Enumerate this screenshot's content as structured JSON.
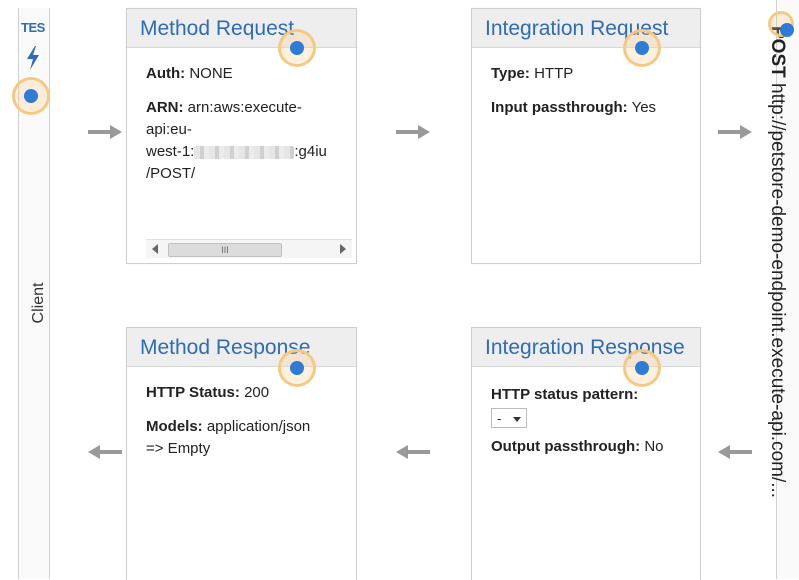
{
  "client": {
    "test_label": "TES",
    "label": "Client"
  },
  "method_request": {
    "title": "Method Request",
    "auth_label": "Auth:",
    "auth_value": "NONE",
    "arn_label": "ARN:",
    "arn_line1": "arn:aws:execute-",
    "arn_line2": "api:eu-",
    "arn_line3_prefix": "west-1:",
    "arn_line3_suffix": ":g4iu",
    "arn_line4": "/POST/",
    "scroll_thumb": "III"
  },
  "integration_request": {
    "title": "Integration Request",
    "type_label": "Type:",
    "type_value": "HTTP",
    "passthrough_label": "Input passthrough:",
    "passthrough_value": "Yes"
  },
  "method_response": {
    "title": "Method Response",
    "status_label": "HTTP Status:",
    "status_value": "200",
    "models_label": "Models:",
    "models_value": "application/json",
    "models_line2": "=> Empty"
  },
  "integration_response": {
    "title": "Integration Response",
    "pattern_label": "HTTP status pattern:",
    "pattern_value": "-",
    "passthrough_label": "Output passthrough:",
    "passthrough_value": "No"
  },
  "endpoint": {
    "method": "POST",
    "url": "http://petstore-demo-endpoint.execute-api.com/..."
  }
}
